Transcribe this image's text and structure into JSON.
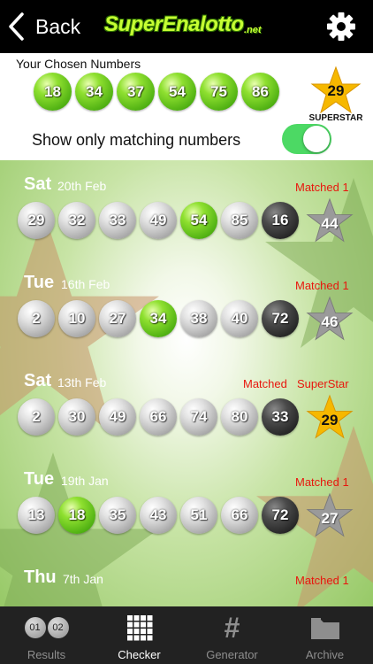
{
  "header": {
    "back_label": "Back",
    "logo_text": "SuperEnalotto",
    "logo_suffix": ".net"
  },
  "chosen": {
    "label": "Your Chosen Numbers",
    "numbers": [
      "18",
      "34",
      "37",
      "54",
      "75",
      "86"
    ],
    "superstar": "29",
    "superstar_label": "SUPERSTAR",
    "toggle_label": "Show only matching numbers",
    "toggle_on": true
  },
  "draws": [
    {
      "day": "Sat",
      "date": "20th Feb",
      "match": "Matched 1",
      "match2": "",
      "balls": [
        {
          "n": "29",
          "c": "grey"
        },
        {
          "n": "32",
          "c": "grey"
        },
        {
          "n": "33",
          "c": "grey"
        },
        {
          "n": "49",
          "c": "grey"
        },
        {
          "n": "54",
          "c": "green"
        },
        {
          "n": "85",
          "c": "grey"
        },
        {
          "n": "16",
          "c": "dark"
        }
      ],
      "star": "44",
      "star_hit": false
    },
    {
      "day": "Tue",
      "date": "16th Feb",
      "match": "Matched 1",
      "match2": "",
      "balls": [
        {
          "n": "2",
          "c": "grey"
        },
        {
          "n": "10",
          "c": "grey"
        },
        {
          "n": "27",
          "c": "grey"
        },
        {
          "n": "34",
          "c": "green"
        },
        {
          "n": "38",
          "c": "grey"
        },
        {
          "n": "40",
          "c": "grey"
        },
        {
          "n": "72",
          "c": "dark"
        }
      ],
      "star": "46",
      "star_hit": false
    },
    {
      "day": "Sat",
      "date": "13th Feb",
      "match": "Matched",
      "match2": "SuperStar",
      "balls": [
        {
          "n": "2",
          "c": "grey"
        },
        {
          "n": "30",
          "c": "grey"
        },
        {
          "n": "49",
          "c": "grey"
        },
        {
          "n": "66",
          "c": "grey"
        },
        {
          "n": "74",
          "c": "grey"
        },
        {
          "n": "80",
          "c": "grey"
        },
        {
          "n": "33",
          "c": "dark"
        }
      ],
      "star": "29",
      "star_hit": true
    },
    {
      "day": "Tue",
      "date": "19th Jan",
      "match": "Matched 1",
      "match2": "",
      "balls": [
        {
          "n": "13",
          "c": "grey"
        },
        {
          "n": "18",
          "c": "green"
        },
        {
          "n": "35",
          "c": "grey"
        },
        {
          "n": "43",
          "c": "grey"
        },
        {
          "n": "51",
          "c": "grey"
        },
        {
          "n": "66",
          "c": "grey"
        },
        {
          "n": "72",
          "c": "dark"
        }
      ],
      "star": "27",
      "star_hit": false
    },
    {
      "day": "Thu",
      "date": "7th Jan",
      "match": "Matched 1",
      "match2": "",
      "balls": [],
      "star": "",
      "star_hit": false
    }
  ],
  "tabs": [
    {
      "label": "Results",
      "icon": "results-balls-icon",
      "active": false,
      "mini": [
        "01",
        "02"
      ]
    },
    {
      "label": "Checker",
      "icon": "grid-icon",
      "active": true
    },
    {
      "label": "Generator",
      "icon": "hash-icon",
      "active": false,
      "glyph": "#"
    },
    {
      "label": "Archive",
      "icon": "folder-icon",
      "active": false
    }
  ],
  "colors": {
    "accent_green": "#4cd964",
    "match_red": "#e8170e",
    "star_gold": "#f6b800",
    "star_grey": "#9a9a9a"
  }
}
